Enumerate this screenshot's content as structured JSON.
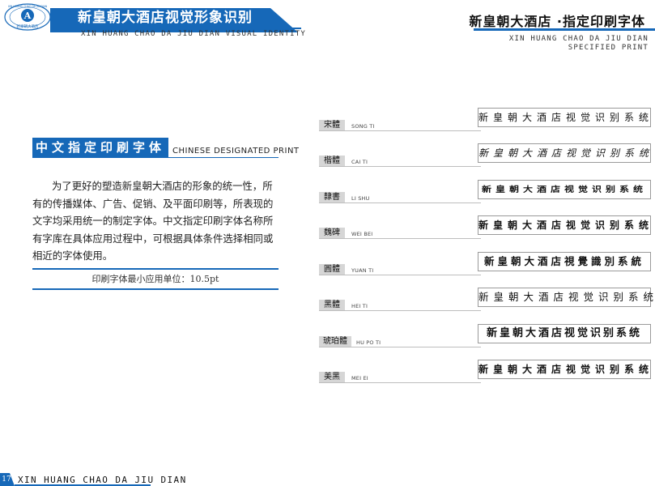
{
  "header": {
    "left_title": "新皇朝大酒店视觉形象识别",
    "left_subtitle": "XIN HUANG CHAO DA JIU DIAN VISUAL IDENTITY",
    "right_title": "新皇朝大酒店 ·指定印刷字体",
    "right_subtitle_line1": "XIN HUANG CHAO DA JIU DIAN",
    "right_subtitle_line2": "SPECIFIED PRINT"
  },
  "logo": {
    "ring_text": "XIN HUANG CHAO DA JIU DIAN",
    "emblem_letter": "A",
    "caption": "新皇朝大酒店"
  },
  "section": {
    "title": "中文指定印刷字体",
    "subtitle_en": "CHINESE DESIGNATED PRINT",
    "paragraph": "为了更好的塑造新皇朝大酒店的形象的统一性，所有的传播媒体、广告、促销、及平面印刷等，所表现的文字均采用统一的制定字体。中文指定印刷字体名称所有字库在具体应用过程中，可根据具体条件选择相同或相近的字体使用。",
    "min_size_text": "印刷字体最小应用单位：10.5pt"
  },
  "font_samples": [
    {
      "name_cn": "宋體",
      "name_en": "SONG TI",
      "sample": "新皇朝大酒店视觉识别系统"
    },
    {
      "name_cn": "楷體",
      "name_en": "CAI TI",
      "sample": "新皇朝大酒店视觉识别系统"
    },
    {
      "name_cn": "隸書",
      "name_en": "LI SHU",
      "sample": "新皇朝大酒店视觉识别系统"
    },
    {
      "name_cn": "魏碑",
      "name_en": "WEI BEI",
      "sample": "新皇朝大酒店视觉识别系统"
    },
    {
      "name_cn": "圓體",
      "name_en": "YUAN TI",
      "sample": "新皇朝大酒店視覺識別系統"
    },
    {
      "name_cn": "黑體",
      "name_en": "HEI TI",
      "sample": "新皇朝大酒店视觉识别系统"
    },
    {
      "name_cn": "琥珀體",
      "name_en": "HU PO TI",
      "sample": "新皇朝大酒店视觉识别系统"
    },
    {
      "name_cn": "美黑",
      "name_en": "MEI EI",
      "sample": "新皇朝大酒店视觉识别系统"
    }
  ],
  "footer": {
    "page_number": "17",
    "text": "XIN HUANG CHAO DA JIU DIAN"
  },
  "colors": {
    "brand_blue": "#1668b8",
    "label_gray": "#d6d6d6"
  }
}
